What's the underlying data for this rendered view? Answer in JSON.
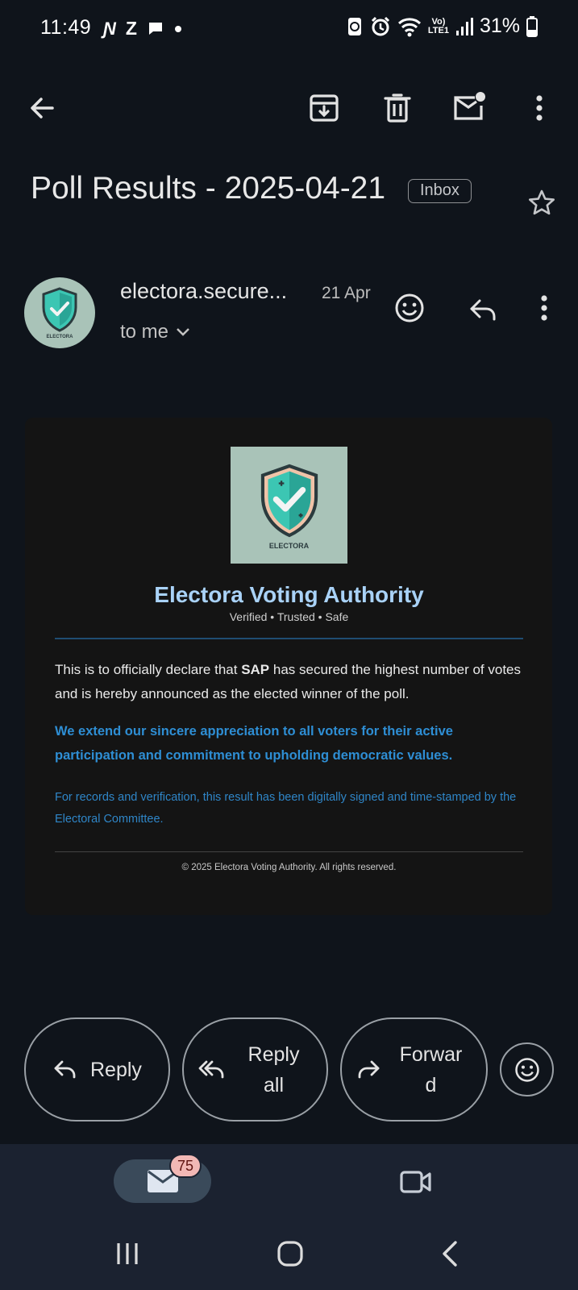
{
  "status_bar": {
    "time": "11:49",
    "battery": "31%",
    "left_icons": [
      "n-icon",
      "z-icon",
      "chat-icon",
      "dot-icon"
    ],
    "right_icons": [
      "rotate-lock-icon",
      "alarm-icon",
      "wifi-icon",
      "volte-icon",
      "signal-icon",
      "battery-icon"
    ]
  },
  "toolbar": {
    "icons": [
      "back-arrow-icon",
      "archive-icon",
      "delete-icon",
      "mark-unread-icon",
      "more-vert-icon"
    ]
  },
  "email": {
    "subject": "Poll Results - 2025-04-21",
    "label": "Inbox",
    "sender": "electora.secure...",
    "date": "21 Apr",
    "recipient": "to me"
  },
  "body": {
    "logo_text": "ELECTORA",
    "org_title": "Electora Voting Authority",
    "tagline": "Verified • Trusted • Safe",
    "para1_before": "This is to officially declare that ",
    "para1_bold": "SAP",
    "para1_after": " has secured the highest number of votes and is hereby announced as the elected winner of the poll.",
    "para2": "We extend our sincere appreciation to all voters for their active participation and commitment to upholding democratic values.",
    "para3": "For records and verification, this result has been digitally signed and time-stamped by the Electoral Committee.",
    "footer": "© 2025 Electora Voting Authority. All rights reserved."
  },
  "actions": {
    "reply": "Reply",
    "reply_all_line1": "Reply",
    "reply_all_line2": "all",
    "forward_line1": "Forwar",
    "forward_line2": "d"
  },
  "bottom_nav": {
    "mail_badge": "75"
  },
  "colors": {
    "background": "#0f141b",
    "accent_title": "#a9d2f7",
    "link_blue": "#2e8ed4",
    "badge": "#f2b8b5"
  }
}
